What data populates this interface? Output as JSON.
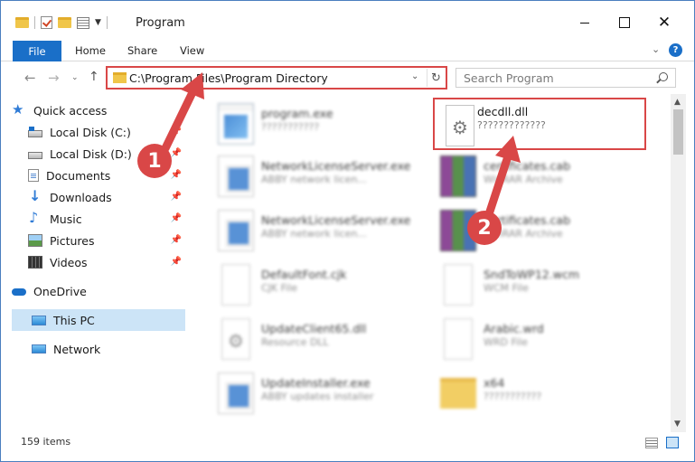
{
  "window": {
    "title": "Program"
  },
  "ribbon": {
    "tabs": [
      "File",
      "Home",
      "Share",
      "View"
    ]
  },
  "address": {
    "path": "C:\\Program Files\\Program Directory"
  },
  "search": {
    "placeholder": "Search Program"
  },
  "sidebar": {
    "quick_access": "Quick access",
    "items": [
      {
        "label": "Local Disk (C:)",
        "icon": "drive-icon",
        "pinned": true
      },
      {
        "label": "Local Disk (D:)",
        "icon": "drive-icon",
        "pinned": true
      },
      {
        "label": "Documents",
        "icon": "documents-icon",
        "pinned": true
      },
      {
        "label": "Downloads",
        "icon": "downloads-icon",
        "pinned": true
      },
      {
        "label": "Music",
        "icon": "music-icon",
        "pinned": true
      },
      {
        "label": "Pictures",
        "icon": "pictures-icon",
        "pinned": true
      },
      {
        "label": "Videos",
        "icon": "videos-icon",
        "pinned": true
      }
    ],
    "onedrive": "OneDrive",
    "this_pc": "This PC",
    "network": "Network"
  },
  "files": [
    {
      "name": "program.exe",
      "type": "???????????",
      "icon": "exe-icon",
      "blurred": true
    },
    {
      "name": "decdll.dll",
      "type": "?????????????",
      "icon": "dll-gear-icon",
      "blurred": false,
      "highlighted": true
    },
    {
      "name": "NetworkLicenseServer.exe",
      "type": "ABBY network licen...",
      "icon": "app-icon",
      "blurred": true
    },
    {
      "name": "certificates.cab",
      "type": "WinRAR Archive",
      "icon": "rar-icon",
      "blurred": true
    },
    {
      "name": "NetworkLicenseServer.exe",
      "type": "ABBY network licen...",
      "icon": "app-icon",
      "blurred": true
    },
    {
      "name": "certificates.cab",
      "type": "WinRAR Archive",
      "icon": "rar-icon",
      "blurred": true
    },
    {
      "name": "DefaultFont.cjk",
      "type": "CJK File",
      "icon": "document-icon",
      "blurred": true
    },
    {
      "name": "SndToWP12.wcm",
      "type": "WCM File",
      "icon": "document-icon",
      "blurred": true
    },
    {
      "name": "UpdateClient65.dll",
      "type": "Resource DLL",
      "icon": "dll-gear-icon",
      "blurred": true
    },
    {
      "name": "Arabic.wrd",
      "type": "WRD File",
      "icon": "document-icon",
      "blurred": true
    },
    {
      "name": "UpdateInstaller.exe",
      "type": "ABBY updates installer",
      "icon": "app-icon",
      "blurred": true
    },
    {
      "name": "x64",
      "type": "???????????",
      "icon": "folder-icon",
      "blurred": true
    }
  ],
  "status": {
    "item_count": "159 items"
  },
  "annotations": {
    "step1": "1",
    "step2": "2",
    "color": "#d94747"
  }
}
